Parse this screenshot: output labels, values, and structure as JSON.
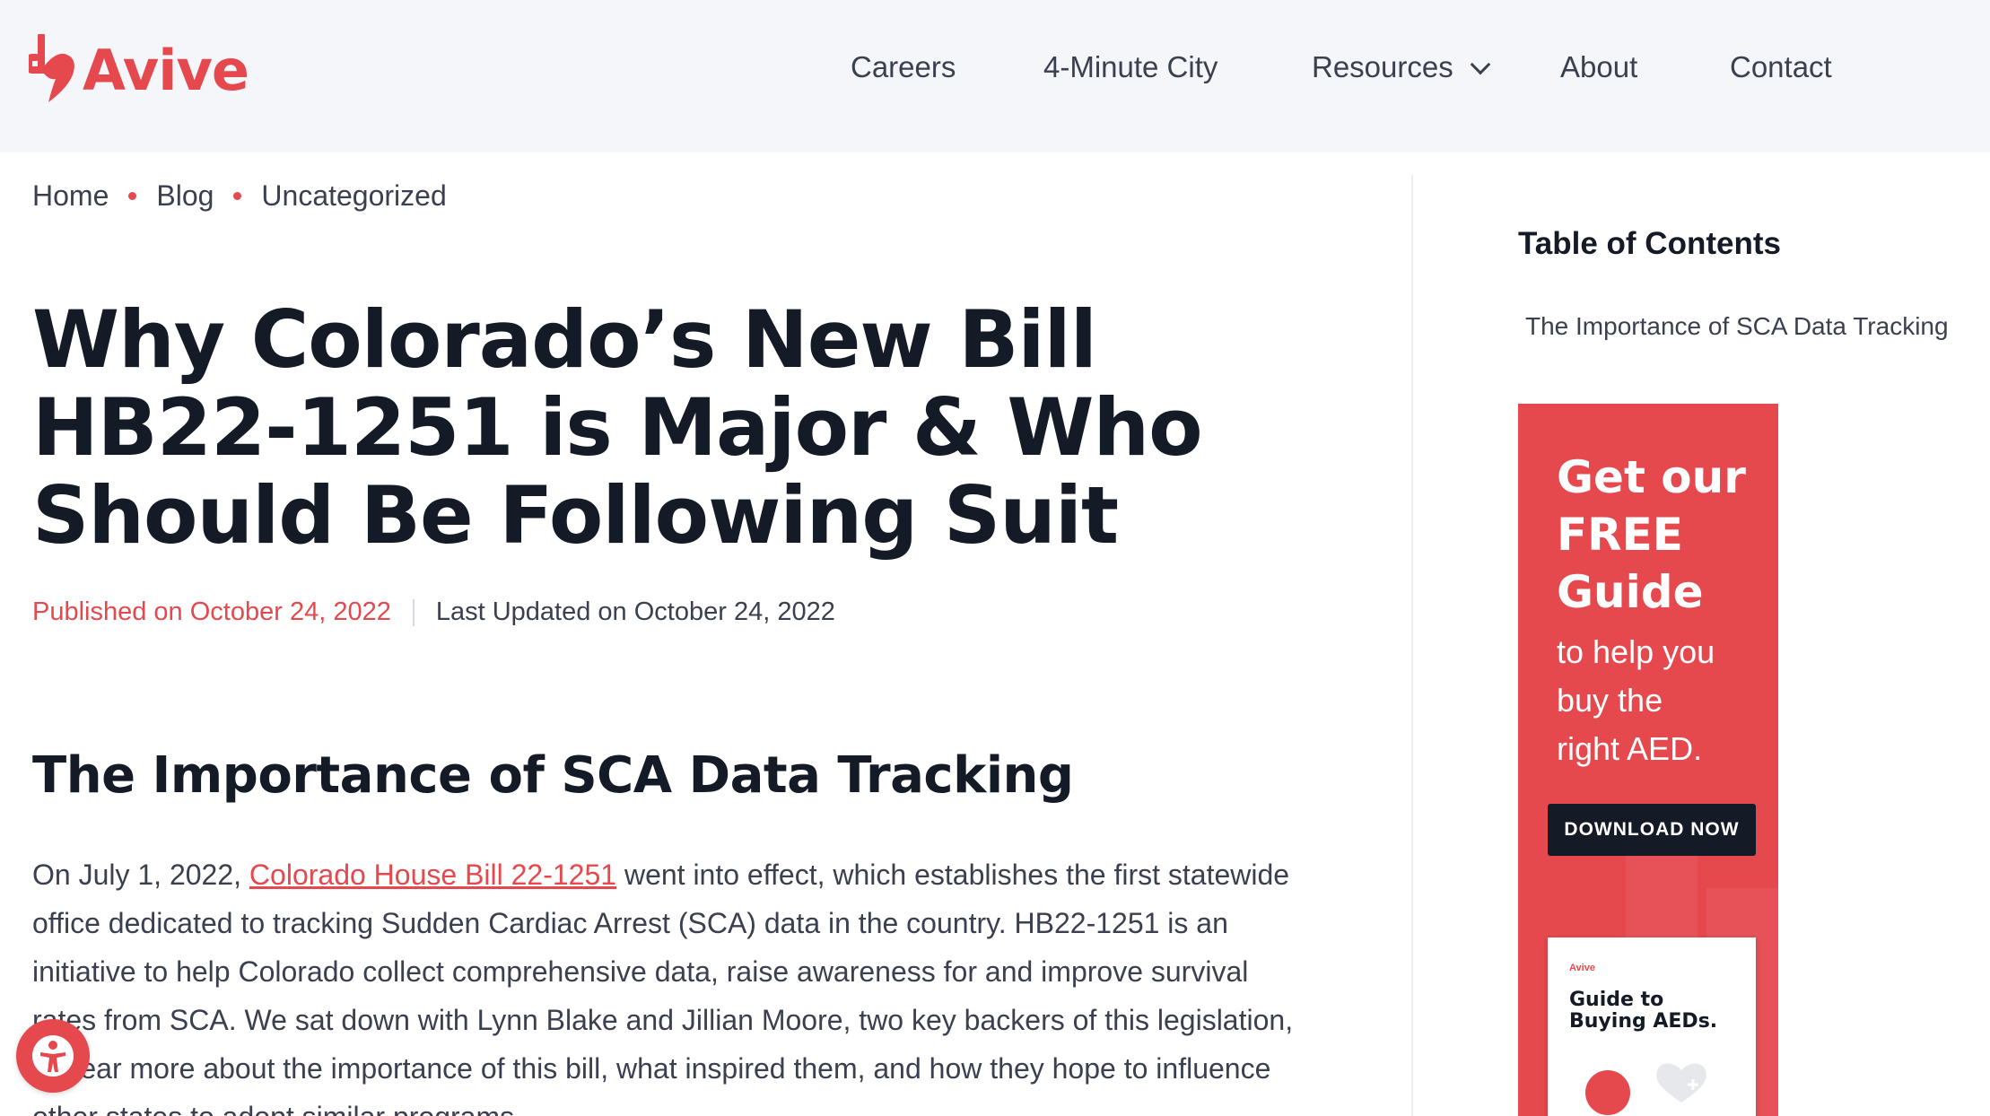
{
  "header": {
    "logo_text": "Avive",
    "nav": [
      {
        "label": "Careers"
      },
      {
        "label": "4-Minute City"
      },
      {
        "label": "Resources"
      },
      {
        "label": "About"
      },
      {
        "label": "Contact"
      }
    ]
  },
  "breadcrumb": [
    "Home",
    "Blog",
    "Uncategorized"
  ],
  "article": {
    "title": "Why Colorado’s New Bill HB22-1251 is Major & Who Should Be Following Suit",
    "published": "Published on October 24, 2022",
    "updated": "Last Updated on October 24, 2022",
    "section_heading": "The Importance of SCA Data Tracking",
    "body_prefix": "On July 1, 2022, ",
    "body_link": "Colorado House Bill 22-1251",
    "body_rest": " went into effect, which establishes the first statewide office dedicated to tracking Sudden Cardiac Arrest (SCA) data in the country. HB22-1251 is an initiative to help Colorado collect comprehensive data, raise awareness for and improve survival rates from SCA. We sat down with Lynn Blake and Jillian Moore, two key backers of this legislation, to hear more about the importance of this bill, what inspired them, and how they hope to influence other states to adopt similar programs."
  },
  "sidebar": {
    "toc_title": "Table of Contents",
    "toc_items": [
      "The Importance of SCA Data Tracking"
    ],
    "ad": {
      "headline_lines": [
        "Get our",
        "FREE",
        "Guide"
      ],
      "sub_lines": [
        "to help you",
        "buy the",
        "right AED."
      ],
      "button": "DOWNLOAD NOW",
      "book_logo": "Avive",
      "book_title_lines": [
        "Guide to",
        "Buying AEDs."
      ]
    }
  },
  "colors": {
    "accent": "#e5484d",
    "dark": "#141a26",
    "header_bg": "#f4f6f9",
    "text": "#3b4050"
  }
}
